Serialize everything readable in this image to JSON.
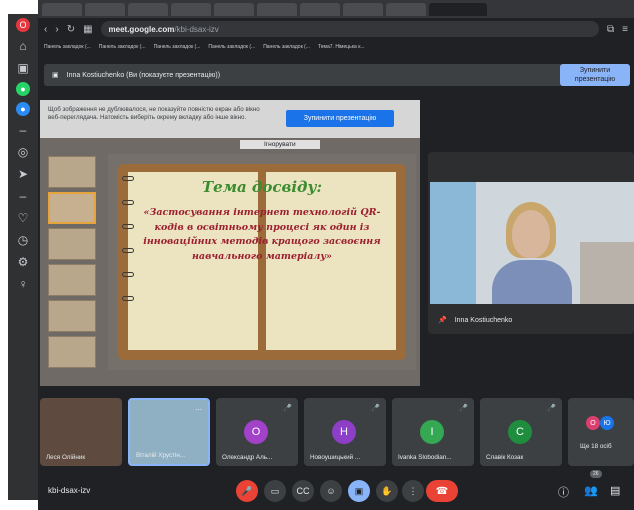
{
  "browser": {
    "url_host": "meet.google.com",
    "url_path": "/kbi-dsax-izv",
    "bookmarks": [
      "Панель закладок (...",
      "Панель закладок (...",
      "Панель закладок (...",
      "Панель закладок (...",
      "Панель закладок (...",
      "Тема7. Німецька к..."
    ]
  },
  "presentation_bar": {
    "text": "Inna Kostiuchenko (Ви (показуєте презентацію))",
    "stop_label": "Зупинити презентацію"
  },
  "shared_screen": {
    "warning": "Щоб зображення не дублювалося, не показуйте повністю екран або вікно веб-переглядача. Натомість виберіть окрему вкладку або інше вікно.",
    "stop_label": "Зупинити презентацію",
    "ignore_label": "Ігнорувати",
    "slide_title": "Тема досвіду:",
    "slide_text": "«Застосування інтернет технологій QR-кодів в освітньому процесі як один із інноваційних методів кращого засвоєння навчального матеріалу»"
  },
  "speaker": {
    "name": "Inna Kostiuchenko"
  },
  "participants": [
    {
      "name": "Леся Олійник",
      "type": "video",
      "muted": false
    },
    {
      "name": "Віталій Хрустін...",
      "type": "video",
      "muted": false
    },
    {
      "name": "Олександр Аль...",
      "initial": "О",
      "color": "#a142c9",
      "muted": true
    },
    {
      "name": "Новоушицький ...",
      "initial": "Н",
      "color": "#8e3fc7",
      "muted": true
    },
    {
      "name": "Ivanka Slobodian...",
      "initial": "I",
      "color": "#34a853",
      "muted": true
    },
    {
      "name": "Славік Козак",
      "initial": "С",
      "color": "#1e8e3e",
      "muted": true
    }
  ],
  "more": {
    "label": "Ще 18 осіб",
    "avatars": [
      "О",
      "Ю"
    ],
    "avatar_colors": [
      "#d93f6f",
      "#1a73e8"
    ]
  },
  "meeting_code": "kbi-dsax-izv",
  "people_count": "26",
  "colors": {
    "accent": "#8ab4f8",
    "end_call": "#ea4335",
    "title_green": "#3b8c2e",
    "text_red": "#9b1f2f"
  }
}
